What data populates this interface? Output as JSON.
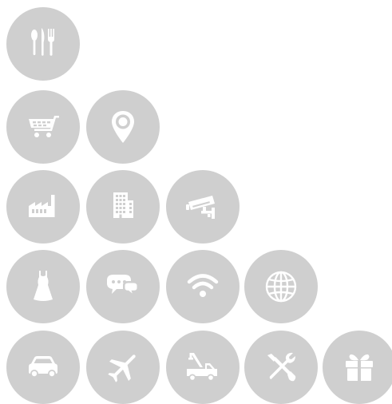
{
  "colors": {
    "circle": "#cfcfcf",
    "glyph": "#ffffff"
  },
  "icons": [
    {
      "id": "c-utensils",
      "name": "utensils-icon"
    },
    {
      "id": "c-cart",
      "name": "shopping-cart-icon"
    },
    {
      "id": "c-pin",
      "name": "map-pin-icon"
    },
    {
      "id": "c-factory",
      "name": "factory-icon"
    },
    {
      "id": "c-building",
      "name": "office-building-icon"
    },
    {
      "id": "c-camera",
      "name": "security-camera-icon"
    },
    {
      "id": "c-dress",
      "name": "dress-icon"
    },
    {
      "id": "c-chat",
      "name": "chat-bubbles-icon"
    },
    {
      "id": "c-wifi",
      "name": "wifi-icon"
    },
    {
      "id": "c-globe",
      "name": "globe-icon"
    },
    {
      "id": "c-car",
      "name": "car-icon"
    },
    {
      "id": "c-plane",
      "name": "airplane-icon"
    },
    {
      "id": "c-crane",
      "name": "crane-truck-icon"
    },
    {
      "id": "c-tools",
      "name": "tools-icon"
    },
    {
      "id": "c-gift",
      "name": "gift-icon"
    }
  ]
}
